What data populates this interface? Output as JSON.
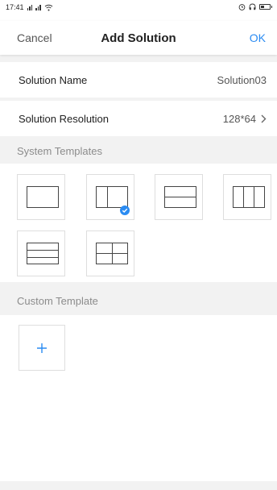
{
  "status_bar": {
    "time": "17:41"
  },
  "nav": {
    "cancel_label": "Cancel",
    "title": "Add Solution",
    "ok_label": "OK"
  },
  "solution_name": {
    "label": "Solution Name",
    "value": "Solution03"
  },
  "solution_resolution": {
    "label": "Solution Resolution",
    "value": "128*64"
  },
  "system_templates": {
    "label": "System Templates",
    "items": [
      {
        "layout": "single",
        "selected": false
      },
      {
        "layout": "left-narrow-split",
        "selected": true
      },
      {
        "layout": "top-two-rows",
        "selected": false
      },
      {
        "layout": "three-columns",
        "selected": false
      },
      {
        "layout": "three-rows",
        "selected": false
      },
      {
        "layout": "quad-grid",
        "selected": false
      }
    ]
  },
  "custom_template": {
    "label": "Custom Template",
    "add_icon": "plus-icon"
  },
  "colors": {
    "accent": "#2a8bf2",
    "background": "#f2f2f2"
  }
}
